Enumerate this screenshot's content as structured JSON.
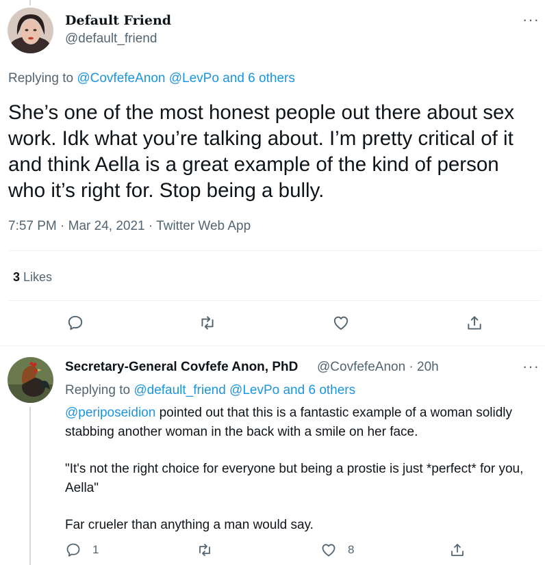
{
  "tweet": {
    "display_name": "Default Friend",
    "handle": "@default_friend",
    "replying_prefix": "Replying to",
    "replying_to": "@CovfefeAnon @LevPo and 6 others",
    "text": "She’s one of the most honest people out there about sex work. Idk what you’re talking about. I’m pretty critical of it and think Aella is a great example of the kind of person who it’s right for. Stop being a bully.",
    "time": "7:57 PM",
    "date": "Mar 24, 2021",
    "source": "Twitter Web App",
    "likes_count": "3",
    "likes_label": "Likes",
    "more_icon": "more-horizontal-icon"
  },
  "reply": {
    "display_name": "Secretary-General Covfefe Anon, PhD",
    "handle": "@CovfefeAnon",
    "age": "20h",
    "replying_prefix": "Replying to",
    "replying_to": "@default_friend @LevPo and 6 others",
    "mention": "@periposeidion",
    "line1_rest": " pointed out that this is a fantastic example of a woman solidly stabbing another woman in the back with a smile on her face.",
    "line2": "\"It's not the right choice for everyone but being a prostie is just *perfect* for you, Aella\"",
    "line3": "Far crueler than anything a man would say.",
    "reply_count": "1",
    "retweet_count": "",
    "like_count": "8"
  },
  "colors": {
    "link": "#1b95e0",
    "secondary_text": "#536471",
    "primary_text": "#0f1419",
    "divider": "#eff3f4"
  }
}
